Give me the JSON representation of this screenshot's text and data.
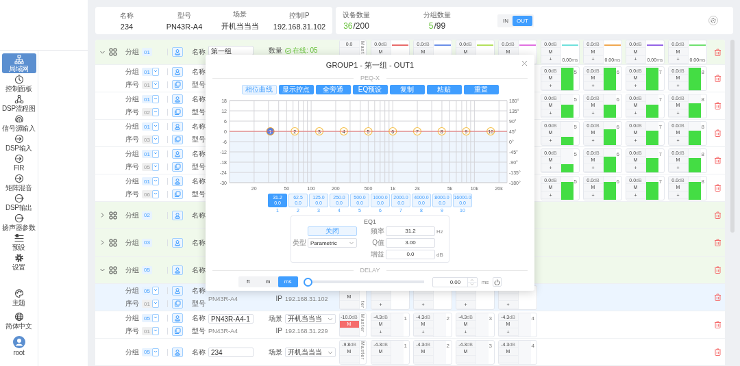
{
  "sidebar": {
    "items": [
      {
        "label": "局域网",
        "selected": true
      },
      {
        "label": "控制面板",
        "selected": false
      },
      {
        "label": "DSP流程图",
        "selected": false
      },
      {
        "label": "信号源输入",
        "selected": false
      },
      {
        "label": "DSP输入",
        "selected": false
      },
      {
        "label": "FIR",
        "selected": false
      },
      {
        "label": "矩阵混音",
        "selected": false
      },
      {
        "label": "DSP输出",
        "selected": false
      },
      {
        "label": "扬声器参数",
        "selected": false
      },
      {
        "label": "预设",
        "selected": false
      },
      {
        "label": "设置",
        "selected": false
      }
    ],
    "bottom_items": [
      {
        "label": "主题"
      },
      {
        "label": "简体中文"
      }
    ],
    "user": {
      "name": "root"
    }
  },
  "device_info": {
    "fields": [
      {
        "label": "名称",
        "value": "234"
      },
      {
        "label": "型号",
        "value": "PN43R-A4"
      },
      {
        "label": "场景",
        "value": "开机当当当"
      },
      {
        "label": "控制IP",
        "value": "192.168.31.102"
      }
    ]
  },
  "stats": [
    {
      "label": "设备数量",
      "count": "36",
      "total": "/200"
    },
    {
      "label": "分组数量",
      "count": "5",
      "total": "/99"
    }
  ],
  "mode_toggle": [
    {
      "label": "IN",
      "selected": false
    },
    {
      "label": "OUT",
      "selected": true
    }
  ],
  "table": {
    "rows": [
      {
        "kind": "group",
        "selected": false,
        "expanded": true,
        "group_label": "分组",
        "group": "01",
        "name_label": "名称",
        "name": "第一组",
        "count_label": "数量",
        "online": "在线: 05",
        "master": {
          "gain": "0.0",
          "label": "Mast"
        },
        "channels": [
          {
            "gain": "0.0",
            "unit": "dB",
            "mute_label": "M",
            "muted": false,
            "color": "#e86a6a"
          },
          {
            "gain": "0.0",
            "unit": "dB",
            "mute_label": "M",
            "muted": false,
            "color": "#6a8ee8"
          },
          {
            "gain": "0.0",
            "unit": "dB",
            "mute_label": "M",
            "muted": false,
            "color": "#b4e05c"
          },
          {
            "gain": "0.0",
            "unit": "dB",
            "mute_label": "M",
            "muted": false,
            "color": "#e070e0"
          }
        ],
        "more_channels": [
          {
            "gain": "0.0",
            "unit": "dB",
            "mute_label": "M",
            "muted": false,
            "plus": "+",
            "color": "#6fe0dc",
            "delay": "0.00",
            "delay_unit": "ms"
          },
          {
            "gain": "0.0",
            "unit": "dB",
            "mute_label": "M",
            "muted": false,
            "plus": "+",
            "color": "#f0a850",
            "delay": "0.00",
            "delay_unit": "ms"
          },
          {
            "gain": "0.0",
            "unit": "dB",
            "mute_label": "M",
            "muted": false,
            "plus": "+",
            "color": "#9363e6",
            "delay": "0.00",
            "delay_unit": "ms"
          },
          {
            "gain": "0.0",
            "unit": "dB",
            "mute_label": "M",
            "muted": false,
            "plus": "+",
            "color": "#6fe06f",
            "delay": "0.00",
            "delay_unit": "ms"
          }
        ]
      },
      {
        "kind": "device",
        "selected": false,
        "group_label": "分组",
        "group": "01",
        "serial_label": "序号",
        "serial": "01",
        "name_label": "名称",
        "model_label": "型号",
        "more_channels": [
          {
            "gain": "0.0",
            "unit": "dB",
            "mute_label": "M",
            "muted": false,
            "plus": "+",
            "level": 0.95,
            "number": "5"
          },
          {
            "gain": "0.0",
            "unit": "dB",
            "mute_label": "M",
            "muted": false,
            "plus": "+",
            "level": 0.95,
            "number": "6"
          },
          {
            "gain": "0.0",
            "unit": "dB",
            "mute_label": "M",
            "muted": false,
            "plus": "+",
            "level": 0.95,
            "number": "7"
          },
          {
            "gain": "0.0",
            "unit": "dB",
            "mute_label": "M",
            "muted": false,
            "plus": "+",
            "level": 0.95,
            "number": "8"
          }
        ]
      },
      {
        "kind": "device",
        "selected": false,
        "group_label": "分组",
        "group": "01",
        "serial_label": "序号",
        "serial": "02",
        "name_label": "名称",
        "model_label": "型号",
        "more_channels": [
          {
            "gain": "0.0",
            "unit": "dB",
            "mute_label": "M",
            "muted": false,
            "plus": "+",
            "level": 0.55,
            "number": "5"
          },
          {
            "gain": "0.0",
            "unit": "dB",
            "mute_label": "M",
            "muted": false,
            "plus": "+",
            "level": 0.55,
            "number": "6"
          },
          {
            "gain": "0.0",
            "unit": "dB",
            "mute_label": "M",
            "muted": false,
            "plus": "+",
            "level": 0.55,
            "number": "7"
          },
          {
            "gain": "0.0",
            "unit": "dB",
            "mute_label": "M",
            "muted": false,
            "plus": "+",
            "level": 0.6,
            "number": "8"
          }
        ]
      },
      {
        "kind": "device",
        "selected": false,
        "group_label": "分组",
        "group": "01",
        "serial_label": "序号",
        "serial": "03",
        "name_label": "名称",
        "model_label": "型号",
        "more_channels": [
          {
            "gain": "0.0",
            "unit": "dB",
            "mute_label": "M",
            "muted": false,
            "plus": "+",
            "level": 0.35,
            "number": "5"
          },
          {
            "gain": "0.0",
            "unit": "dB",
            "mute_label": "M",
            "muted": false,
            "plus": "+",
            "level": 0.65,
            "number": "6"
          },
          {
            "gain": "0.0",
            "unit": "dB",
            "mute_label": "M",
            "muted": false,
            "plus": "+",
            "level": 0.6,
            "number": "7"
          },
          {
            "gain": "0.0",
            "unit": "dB",
            "mute_label": "M",
            "muted": false,
            "plus": "+",
            "level": 0.6,
            "number": "8"
          }
        ]
      },
      {
        "kind": "device",
        "selected": false,
        "group_label": "分组",
        "group": "01",
        "serial_label": "序号",
        "serial": "05",
        "name_label": "名称",
        "model_label": "型号",
        "more_channels": [
          {
            "gain": "0.0",
            "unit": "dB",
            "mute_label": "M",
            "muted": false,
            "plus": "+",
            "level": 0.35,
            "number": "5"
          },
          {
            "gain": "0.0",
            "unit": "dB",
            "mute_label": "M",
            "muted": false,
            "plus": "+",
            "level": 0.65,
            "number": "6"
          },
          {
            "gain": "0.0",
            "unit": "dB",
            "mute_label": "M",
            "muted": false,
            "plus": "+",
            "level": 0.6,
            "number": "7"
          },
          {
            "gain": "0.0",
            "unit": "dB",
            "mute_label": "M",
            "muted": false,
            "plus": "+",
            "level": 0.6,
            "number": "8"
          }
        ]
      },
      {
        "kind": "device",
        "selected": false,
        "group_label": "分组",
        "group": "01",
        "serial_label": "序号",
        "serial": "06",
        "name_label": "名称",
        "model_label": "型号",
        "more_channels": [
          {
            "gain": "0.0",
            "unit": "dB",
            "mute_label": "M",
            "muted": false,
            "plus": "+",
            "level": 0.75,
            "number": "5"
          },
          {
            "gain": "0.0",
            "unit": "dB",
            "mute_label": "M",
            "muted": false,
            "plus": "+",
            "level": 0.75,
            "number": "6"
          },
          {
            "gain": "0.0",
            "unit": "dB",
            "mute_label": "M",
            "muted": false,
            "plus": "+",
            "level": 0.75,
            "number": "7"
          },
          {
            "gain": "0.0",
            "unit": "dB",
            "mute_label": "M",
            "muted": false,
            "plus": "+",
            "level": 0.75,
            "number": "8"
          }
        ]
      },
      {
        "kind": "group",
        "selected": false,
        "expanded": false,
        "group_label": "分组",
        "group": "02",
        "name_label": "名称"
      },
      {
        "kind": "group",
        "selected": false,
        "expanded": false,
        "group_label": "分组",
        "group": "03",
        "name_label": "名称"
      },
      {
        "kind": "group",
        "selected": false,
        "expanded": true,
        "group_label": "分组",
        "group": "05",
        "name_label": "名称"
      },
      {
        "kind": "device",
        "selected": true,
        "group_label": "分组",
        "group": "05",
        "serial_label": "序号",
        "serial": "01",
        "name_label": "名称",
        "model_label": "型号",
        "model": "PN43R-A4",
        "ip_label": "IP",
        "ip": "192.168.31.102",
        "master": {
          "mute_label": "M",
          "muted": false,
          "label": "ter"
        },
        "channels": [
          {
            "plus": "+"
          },
          {
            "plus": "+"
          },
          {
            "plus": "+"
          },
          {
            "plus": "+"
          }
        ]
      },
      {
        "kind": "device",
        "selected": false,
        "group_label": "分组",
        "group": "05",
        "serial_label": "序号",
        "serial": "01",
        "name_label": "名称",
        "name": "PN43R-A4-1",
        "scene_label": "场景",
        "scene": "开机当当当",
        "model_label": "型号",
        "model": "PN43R-A4",
        "ip_label": "IP",
        "ip": "192.168.31.229",
        "master": {
          "gain": "-10.0",
          "unit": "dB",
          "mute_label": "M",
          "muted": true,
          "label": "Master"
        },
        "channels": [
          {
            "gain": "-4.3",
            "unit": "dB",
            "mute_label": "M",
            "muted": false,
            "plus": "+",
            "level": 0,
            "number": "1"
          },
          {
            "gain": "-4.3",
            "unit": "dB",
            "mute_label": "M",
            "muted": false,
            "plus": "+",
            "level": 0,
            "number": "2"
          },
          {
            "gain": "-4.3",
            "unit": "dB",
            "mute_label": "M",
            "muted": false,
            "plus": "+",
            "level": 0,
            "number": "3"
          },
          {
            "gain": "-4.3",
            "unit": "dB",
            "mute_label": "M",
            "muted": false,
            "plus": "+",
            "level": 0,
            "number": "4"
          }
        ]
      },
      {
        "kind": "device",
        "selected": false,
        "group_label": "分组",
        "group": "05",
        "name_label": "名称",
        "name": "234",
        "scene_label": "场景",
        "scene": "开机当当当",
        "master": {
          "gain": "-9.8",
          "unit": "dB",
          "mute_label": "M",
          "muted": false,
          "label": "Master"
        },
        "channels": [
          {
            "gain": "-4.3",
            "unit": "dB",
            "mute_label": "M",
            "muted": false,
            "level": 0,
            "number": "1"
          },
          {
            "gain": "-4.3",
            "unit": "dB",
            "mute_label": "M",
            "muted": false,
            "level": 0,
            "number": "2"
          },
          {
            "gain": "-4.3",
            "unit": "dB",
            "mute_label": "M",
            "muted": false,
            "level": 0,
            "number": "3"
          },
          {
            "gain": "-4.3",
            "unit": "dB",
            "mute_label": "M",
            "muted": false,
            "level": 0,
            "number": "4"
          }
        ]
      }
    ]
  },
  "dialog": {
    "title": "GROUP1 - 第一组 - OUT1",
    "peq_label": "PEQ-X",
    "toolbar": [
      {
        "label": "相位曲线",
        "kind": "toggle"
      },
      {
        "label": "显示控点",
        "kind": "action"
      },
      {
        "label": "全旁通",
        "kind": "action"
      },
      {
        "label": "EQ预设",
        "kind": "action"
      },
      {
        "label": "复制",
        "kind": "action"
      },
      {
        "label": "粘贴",
        "kind": "action"
      },
      {
        "label": "重置",
        "kind": "action"
      }
    ],
    "eq_graph": {
      "phase_ticks": [
        "180°",
        "135°",
        "90°",
        "45°",
        "0°",
        "-45°",
        "-90°",
        "-135°",
        "-180°"
      ],
      "points": [
        {
          "label": "1",
          "selected": true
        },
        {
          "label": "2",
          "selected": false
        },
        {
          "label": "3",
          "selected": false
        },
        {
          "label": "4",
          "selected": false
        },
        {
          "label": "5",
          "selected": false
        },
        {
          "label": "6",
          "selected": false
        },
        {
          "label": "7",
          "selected": false
        },
        {
          "label": "8",
          "selected": false
        },
        {
          "label": "9",
          "selected": false
        },
        {
          "label": "10",
          "selected": false
        }
      ],
      "chart_data": {
        "type": "line",
        "grid": true,
        "categories": [
          null,
          null,
          null,
          "20",
          null,
          null,
          null,
          "50",
          null,
          null,
          "100",
          null,
          null,
          "200",
          null,
          null,
          null,
          "500",
          null,
          null,
          "1k",
          null,
          null,
          "2k",
          null,
          null,
          null,
          "5k",
          null,
          null,
          "10k",
          null,
          null,
          "20k",
          null
        ],
        "series": [
          {
            "color": "#e86a6a",
            "values": [
              0,
              0,
              0,
              0,
              0,
              0,
              0,
              0,
              0,
              0,
              0,
              0,
              0,
              0,
              0,
              0,
              0,
              0,
              0,
              0,
              0,
              0,
              0,
              0,
              0,
              0,
              0,
              0,
              0,
              0,
              0,
              0,
              0,
              0,
              0
            ]
          }
        ],
        "ylim": [
          -30,
          18
        ],
        "yticks": [
          18,
          12,
          6,
          0,
          -6,
          -12,
          -18,
          -24,
          -30
        ]
      }
    },
    "bands": [
      {
        "freq": "31.2",
        "gain": "0.0",
        "index": "1",
        "selected": true
      },
      {
        "freq": "62.5",
        "gain": "0.0",
        "index": "2",
        "selected": false
      },
      {
        "freq": "125.0",
        "gain": "0.0",
        "index": "3",
        "selected": false
      },
      {
        "freq": "250.0",
        "gain": "0.0",
        "index": "4",
        "selected": false
      },
      {
        "freq": "500.0",
        "gain": "0.0",
        "index": "5",
        "selected": false
      },
      {
        "freq": "1000.0",
        "gain": "0.0",
        "index": "6",
        "selected": false
      },
      {
        "freq": "2000.0",
        "gain": "0.0",
        "index": "7",
        "selected": false
      },
      {
        "freq": "4000.0",
        "gain": "0.0",
        "index": "8",
        "selected": false
      },
      {
        "freq": "8000.0",
        "gain": "0.0",
        "index": "9",
        "selected": false
      },
      {
        "freq": "16000.0",
        "gain": "0.0",
        "index": "10",
        "selected": false
      }
    ],
    "eq_panel": {
      "title": "EQ1",
      "bypass_button": "关闭",
      "type_label": "类型",
      "type_value": "Parametric",
      "fields": [
        {
          "label": "频率",
          "value": "31.2",
          "unit": "Hz"
        },
        {
          "label": "Q值",
          "value": "3.00"
        },
        {
          "label": "增益",
          "value": "0.0",
          "unit": "dB"
        }
      ]
    },
    "delay_label": "DELAY",
    "delay": {
      "units": [
        {
          "label": "ft",
          "selected": false
        },
        {
          "label": "m",
          "selected": false
        },
        {
          "label": "ms",
          "selected": true
        }
      ],
      "level": 0,
      "value": "0.00",
      "unit": "ms"
    }
  }
}
